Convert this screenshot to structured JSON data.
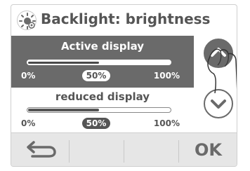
{
  "header": {
    "title": "Backlight: brightness",
    "icon": "brightness-icon"
  },
  "active_display": {
    "label": "Active display",
    "min_label": "0%",
    "max_label": "100%",
    "value_label": "50%",
    "value": 50
  },
  "reduced_display": {
    "label": "reduced display",
    "min_label": "0%",
    "max_label": "100%",
    "value_label": "50%",
    "value": 50
  },
  "side_buttons": {
    "up_icon": "chevron-up-icon",
    "down_icon": "chevron-down-icon"
  },
  "footer": {
    "back_icon": "back-arrow-icon",
    "ok_label": "OK"
  },
  "colors": {
    "dark": "#6a6a6a",
    "text": "#555555",
    "footer_bg": "#e6e6e6"
  }
}
